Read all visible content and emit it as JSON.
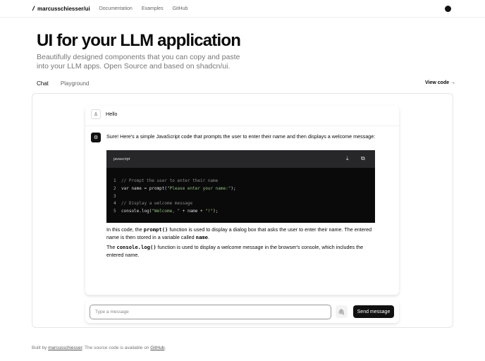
{
  "header": {
    "brand": "marcusschiesser/ui",
    "nav": [
      "Documentation",
      "Examples",
      "GitHub"
    ]
  },
  "hero": {
    "title": "UI for your LLM application",
    "subtitle": "Beautifully designed components that you can copy and paste into your LLM apps. Open Source and based on shadcn/ui."
  },
  "tabs": [
    "Chat",
    "Playground"
  ],
  "view_code": "View code →",
  "chat": {
    "user_message": "Hello",
    "bot_intro": "Sure! Here's a simple JavaScript code that prompts the user to enter their name and then displays a welcome message:",
    "code_language": "javascript",
    "code_lines": [
      "// Prompt the user to enter their name",
      "var name = prompt(\"Please enter your name:\");",
      "",
      "// Display a welcome message",
      "console.log(\"Welcome, \" + name + \"!\");"
    ],
    "p1_a": "In this code, the ",
    "p1_code": "prompt()",
    "p1_b": " function is used to display a dialog box that asks the user to enter their name. The entered name is then stored in a variable called ",
    "p1_code2": "name",
    "p1_c": ".",
    "p2_a": "The ",
    "p2_code": "console.log()",
    "p2_b": " function is used to display a welcome message in the browser's console, which includes the entered name."
  },
  "input": {
    "placeholder": "Type a message",
    "send_label": "Send message"
  },
  "footer": {
    "a": "Built by ",
    "link1": "marcusschiesser",
    "b": ". The source code is available on ",
    "link2": "GitHub",
    "c": "."
  }
}
